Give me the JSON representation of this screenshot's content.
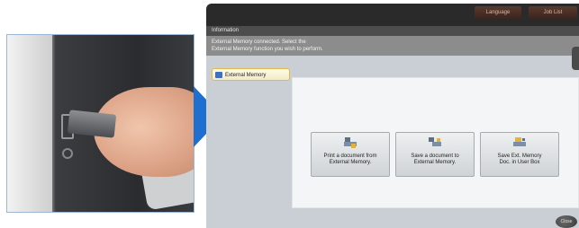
{
  "screen": {
    "top_buttons": [
      "Language",
      "Job List"
    ],
    "info_title": "Information",
    "message": [
      "External Memory connected. Select the",
      "External Memory function you wish to perform."
    ],
    "tab_label": "External Memory",
    "buttons": [
      {
        "line1": "Print a document from",
        "line2": "External Memory."
      },
      {
        "line1": "Save a document to",
        "line2": "External Memory."
      },
      {
        "line1": "Save Ext. Memory",
        "line2": "Doc. in User Box"
      }
    ],
    "close_label": "Close"
  },
  "colors": {
    "arrow": "#1f6fd1",
    "tab_border": "#e0b84c",
    "panel": "#f4f5f6"
  },
  "icons": [
    "usb-drive-photo",
    "printer-icon",
    "save-icon",
    "user-box-icon"
  ]
}
